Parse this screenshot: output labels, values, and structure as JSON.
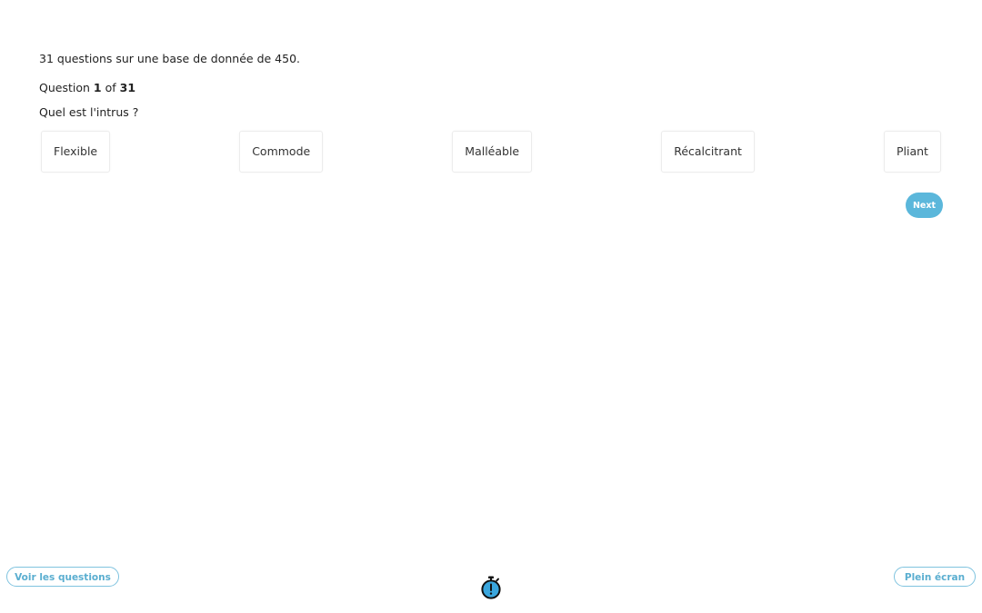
{
  "quiz": {
    "intro": "31 questions sur une base de donnée de 450.",
    "counter": {
      "prefix": "Question",
      "current": "1",
      "of": "of",
      "total": "31"
    },
    "question": "Quel est l'intrus ?",
    "answers": [
      "Flexible",
      "Commode",
      "Malléable",
      "Récalcitrant",
      "Pliant"
    ],
    "next_label": "Next"
  },
  "footer": {
    "questions_label": "Voir les questions",
    "fullscreen_label": "Plein écran",
    "timer_icon": "stopwatch-icon"
  },
  "colors": {
    "accent": "#5bb7db",
    "timer_face": "#3aa6dd"
  }
}
